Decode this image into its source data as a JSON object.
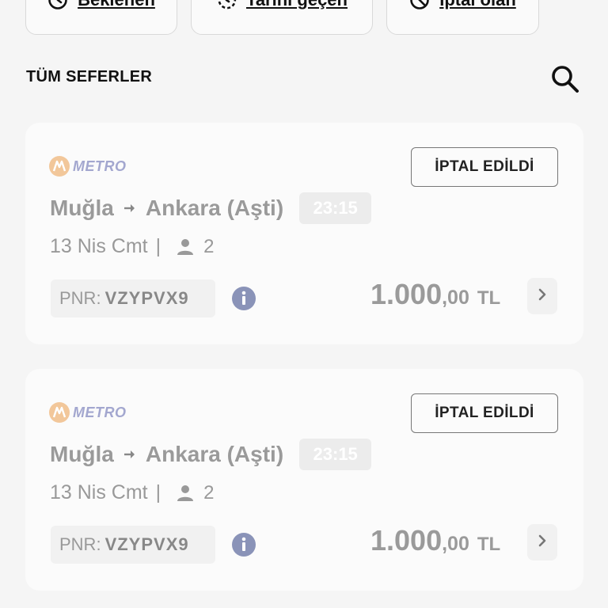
{
  "filters": [
    {
      "label": "Beklenen",
      "icon": "clock-icon"
    },
    {
      "label": "Tarihi geçen",
      "icon": "history-icon"
    },
    {
      "label": "İptal olan",
      "icon": "cancel-icon"
    }
  ],
  "section": {
    "title": "TÜM SEFERLER"
  },
  "colors": {
    "muted": "#9a9a9a",
    "logo_orange": "#f2c79a",
    "logo_text": "#a3a7cf"
  },
  "trips": [
    {
      "operator": "METRO",
      "status": "İPTAL EDİLDİ",
      "from": "Muğla",
      "to": "Ankara (Aşti)",
      "time": "23:15",
      "date": "13 Nis Cmt",
      "separator": "|",
      "passengers": "2",
      "pnr_label": "PNR:",
      "pnr": "VZYPVX9",
      "price_main": "1.000",
      "price_decimal": ",00",
      "currency": "TL"
    },
    {
      "operator": "METRO",
      "status": "İPTAL EDİLDİ",
      "from": "Muğla",
      "to": "Ankara (Aşti)",
      "time": "23:15",
      "date": "13 Nis Cmt",
      "separator": "|",
      "passengers": "2",
      "pnr_label": "PNR:",
      "pnr": "VZYPVX9",
      "price_main": "1.000",
      "price_decimal": ",00",
      "currency": "TL"
    }
  ]
}
